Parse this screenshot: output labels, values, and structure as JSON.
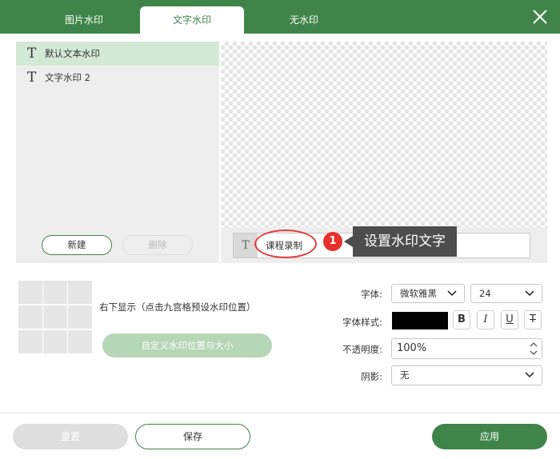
{
  "tabs": [
    {
      "label": "图片水印",
      "active": false
    },
    {
      "label": "文字水印",
      "active": true
    },
    {
      "label": "无水印",
      "active": false
    }
  ],
  "watermark_list": [
    {
      "icon": "text-type-icon",
      "label": "默认文本水印",
      "selected": true
    },
    {
      "icon": "text-type-icon",
      "label": "文字水印 2",
      "selected": false
    }
  ],
  "list_actions": {
    "new_label": "新建",
    "delete_label": "删除"
  },
  "text_input": {
    "value": "课程录制"
  },
  "callout": {
    "number": "1",
    "text": "设置水印文字"
  },
  "position": {
    "description": "右下显示（点击九宫格预设水印位置）",
    "custom_button": "自定义水印位置与大小"
  },
  "settings": {
    "font_label": "字体:",
    "font_value": "微软雅黑",
    "size_value": "24",
    "style_label": "字体样式:",
    "color": "#000000",
    "style_buttons": {
      "bold": "B",
      "italic": "I",
      "underline": "U",
      "strike": "T"
    },
    "opacity_label": "不透明度:",
    "opacity_value": "100%",
    "shadow_label": "阴影:",
    "shadow_value": "无"
  },
  "footer": {
    "reset_label": "重置",
    "save_label": "保存",
    "apply_label": "应用"
  },
  "colors": {
    "accent": "#3f8549",
    "callout_red": "#e8302c",
    "callout_bg": "#4d4d4d"
  }
}
